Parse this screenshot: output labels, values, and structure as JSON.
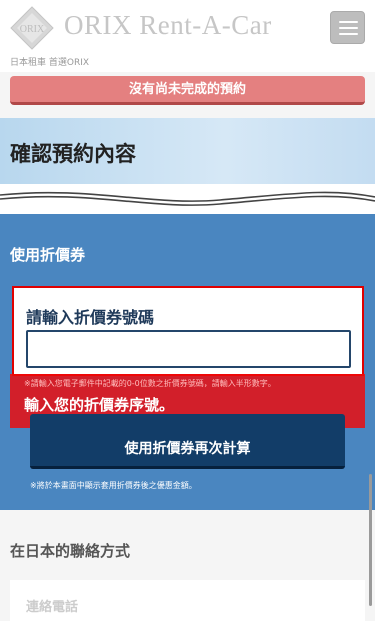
{
  "header": {
    "logo_text": "ORIX Rent-A-Car",
    "logo_mark_text": "ORIX",
    "tagline": "日本租車 首選ORIX",
    "menu_icon": "hamburger-icon"
  },
  "notice": {
    "text": "沒有尚未完成的預約"
  },
  "page": {
    "title": "確認預約內容"
  },
  "coupon": {
    "heading": "使用折價券",
    "input_label": "請輸入折價券號碼",
    "input_value": "",
    "error_note": "※請輸入您電子郵件中記載的0-0位數之折價券號碼，請輸入半形數字。",
    "error_message": "輸入您的折價券序號。",
    "recalc_button": "使用折價券再次計算",
    "footnote": "※將於本畫面中顯示套用折價券後之優惠金額。"
  },
  "contact": {
    "heading": "在日本的聯絡方式",
    "phone_label": "連絡電話"
  },
  "colors": {
    "brand_blue": "#4a86c0",
    "button_navy": "#123d68",
    "notice_red": "#e48080",
    "error_red": "#f00808"
  }
}
